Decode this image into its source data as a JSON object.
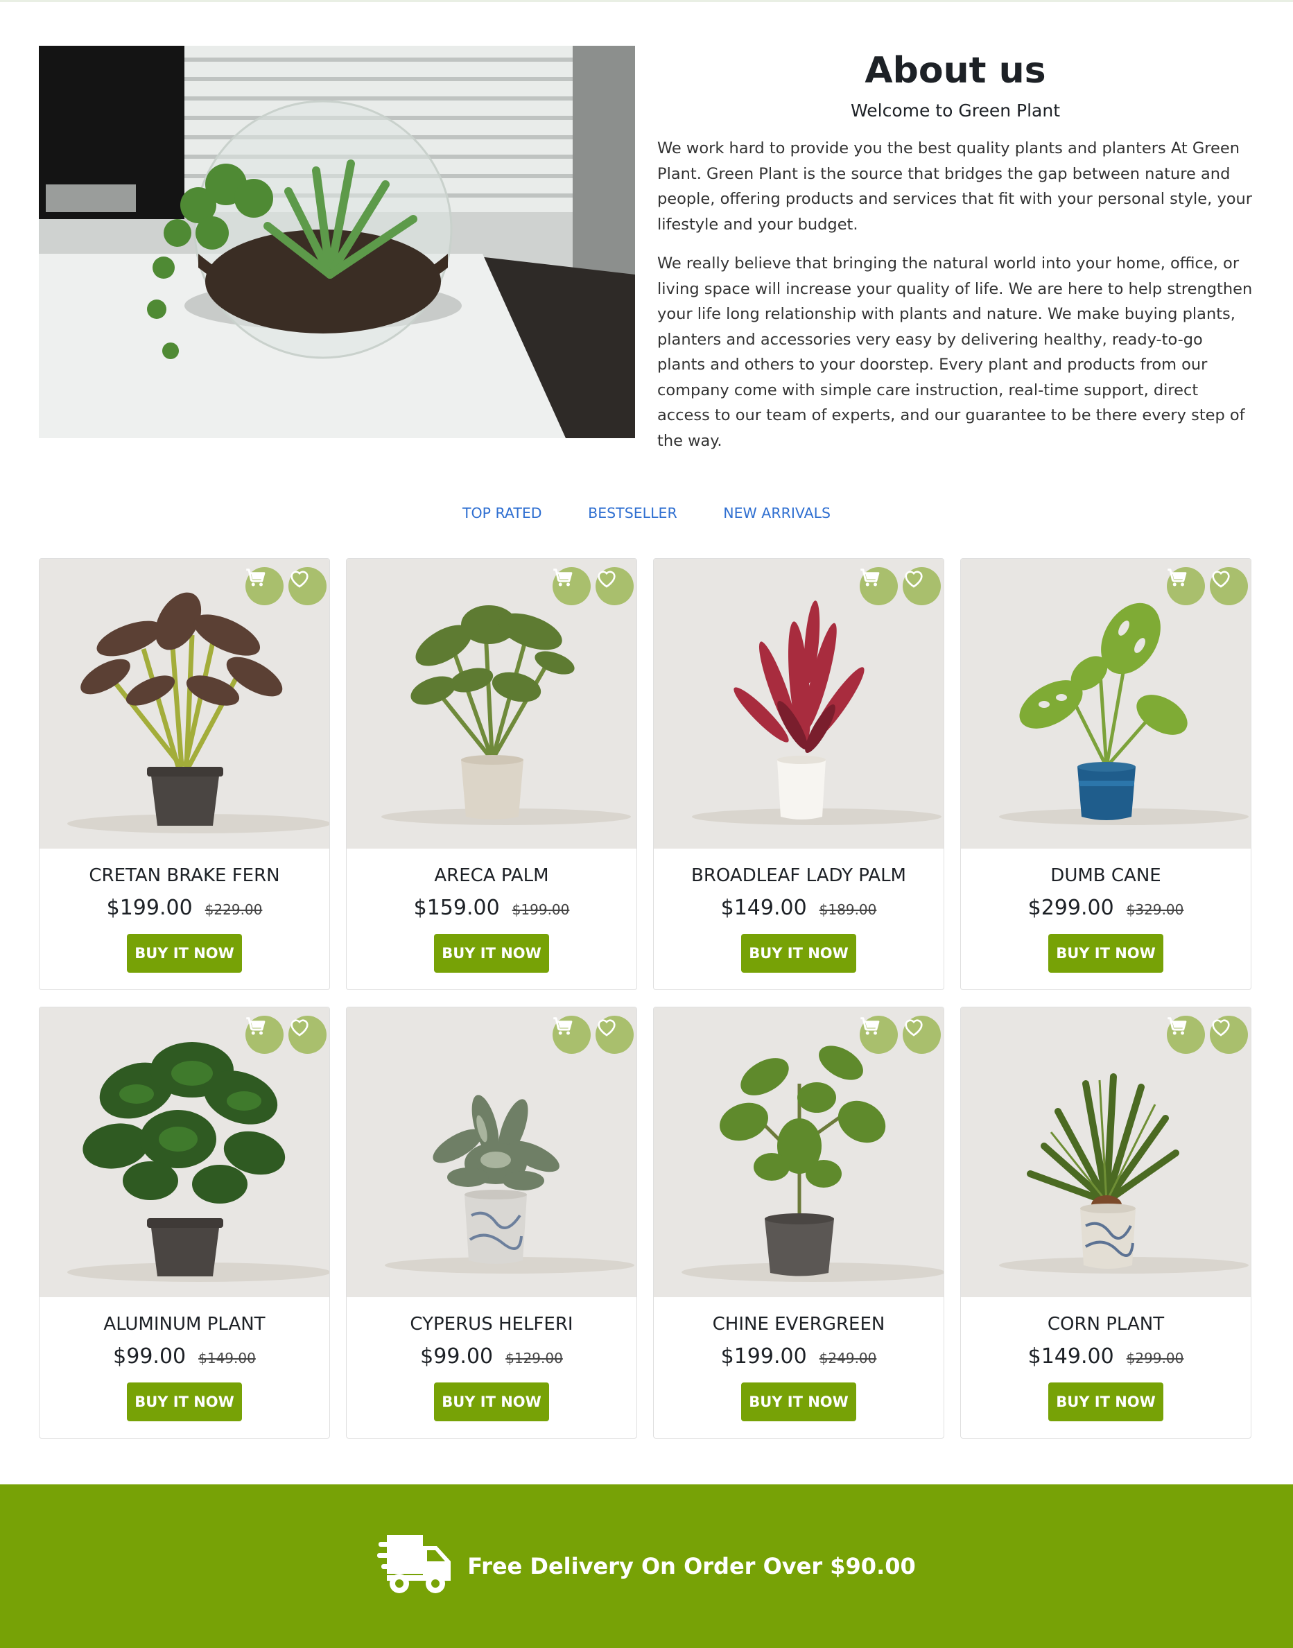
{
  "about": {
    "title": "About us",
    "subtitle": "Welcome to Green Plant",
    "paragraph1": "We work hard to provide you the best quality plants and planters At Green Plant. Green Plant is the source that bridges the gap between nature and people, offering products and services that fit with your personal style, your lifestyle and your budget.",
    "paragraph2": "We really believe that bringing the natural world into your home, office, or living space will increase your quality of life. We are here to help strengthen your life long relationship with plants and nature. We make buying plants, planters and accessories very easy by delivering healthy, ready-to-go plants and others to your doorstep. Every plant and products from our company come with simple care instruction, real-time support, direct access to our team of experts, and our guarantee to be there every step of the way.",
    "image_icon": "terrarium-photo"
  },
  "tabs": [
    "TOP RATED",
    "BESTSELLER",
    "NEW ARRIVALS"
  ],
  "products": [
    {
      "name": "CRETAN BRAKE FERN",
      "price": "$199.00",
      "old_price": "$229.00",
      "button": "BUY IT NOW"
    },
    {
      "name": "ARECA PALM",
      "price": "$159.00",
      "old_price": "$199.00",
      "button": "BUY IT NOW"
    },
    {
      "name": "BROADLEAF LADY PALM",
      "price": "$149.00",
      "old_price": "$189.00",
      "button": "BUY IT NOW"
    },
    {
      "name": "DUMB CANE",
      "price": "$299.00",
      "old_price": "$329.00",
      "button": "BUY IT NOW"
    },
    {
      "name": "ALUMINUM PLANT",
      "price": "$99.00",
      "old_price": "$149.00",
      "button": "BUY IT NOW"
    },
    {
      "name": "CYPERUS HELFERI",
      "price": "$99.00",
      "old_price": "$129.00",
      "button": "BUY IT NOW"
    },
    {
      "name": "CHINE EVERGREEN",
      "price": "$199.00",
      "old_price": "$249.00",
      "button": "BUY IT NOW"
    },
    {
      "name": "CORN PLANT",
      "price": "$149.00",
      "old_price": "$299.00",
      "button": "BUY IT NOW"
    }
  ],
  "card_icons": {
    "cart": "cart-icon",
    "wishlist": "heart-icon"
  },
  "banner": {
    "text": "Free Delivery On Order Over $90.00",
    "icon": "delivery-truck-icon"
  },
  "colors": {
    "accent": "#77a206",
    "icon_bg": "#a9bf6d",
    "link": "#2f6fd1",
    "card_bg": "#e8e6e3"
  }
}
